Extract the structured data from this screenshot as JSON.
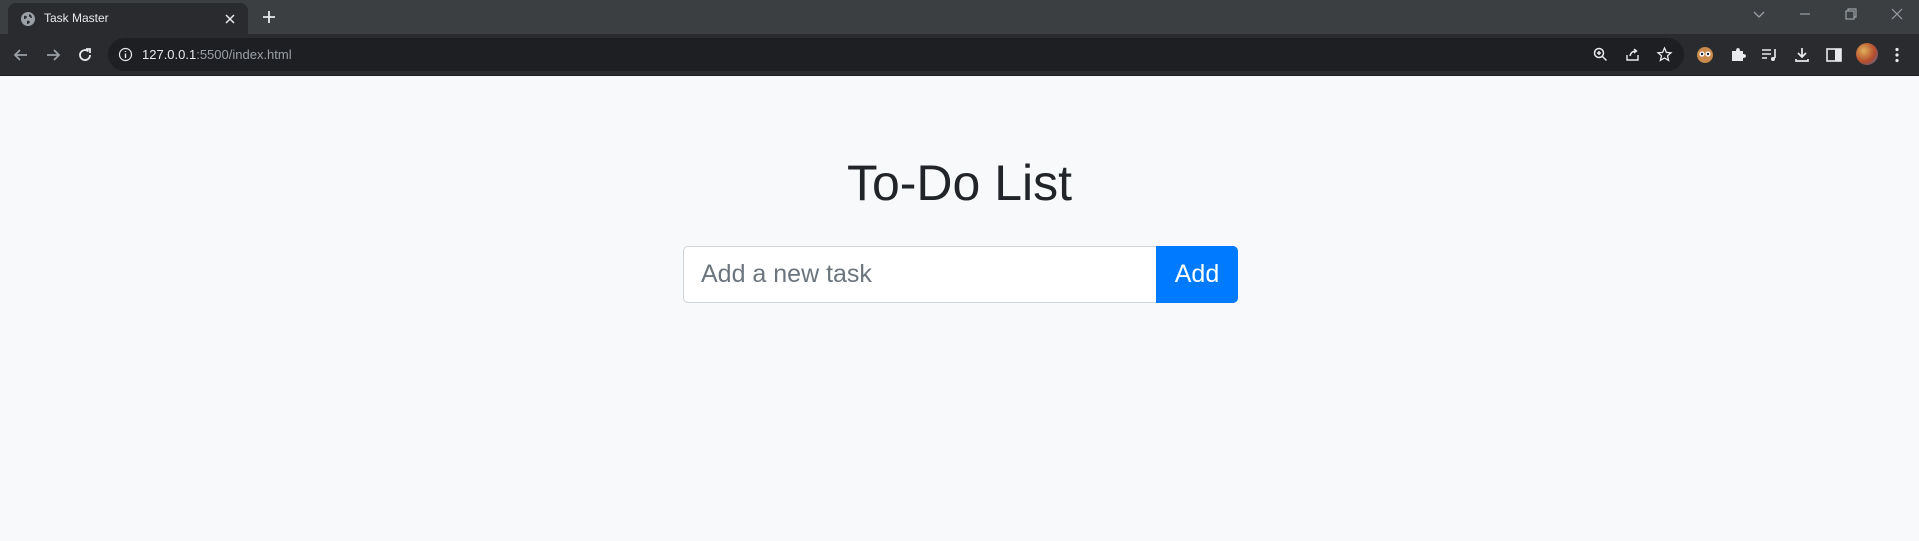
{
  "browser": {
    "tab": {
      "title": "Task Master"
    },
    "address_bar": {
      "host": "127.0.0.1",
      "path": ":5500/index.html"
    },
    "colors": {
      "chrome_dark": "#292b2e",
      "tabstrip": "#3c3f42",
      "omnibox": "#1e1f22"
    }
  },
  "page": {
    "title": "To-Do List",
    "task_input": {
      "placeholder": "Add a new task",
      "value": ""
    },
    "add_button": {
      "label": "Add"
    },
    "colors": {
      "background": "#f8f9fa",
      "primary": "#007bff",
      "text": "#212529"
    }
  },
  "icons": {
    "favicon": "globe-icon",
    "tab_close": "close-icon",
    "new_tab": "plus-icon",
    "back": "arrow-left-icon",
    "forward": "arrow-right-icon",
    "reload": "reload-icon",
    "site_info": "info-icon",
    "zoom": "zoom-icon",
    "share": "share-icon",
    "bookmark": "star-icon",
    "extensions": "puzzle-icon",
    "media": "media-icon",
    "downloads": "download-icon",
    "side_panel": "side-panel-icon",
    "menu": "kebab-menu-icon"
  }
}
